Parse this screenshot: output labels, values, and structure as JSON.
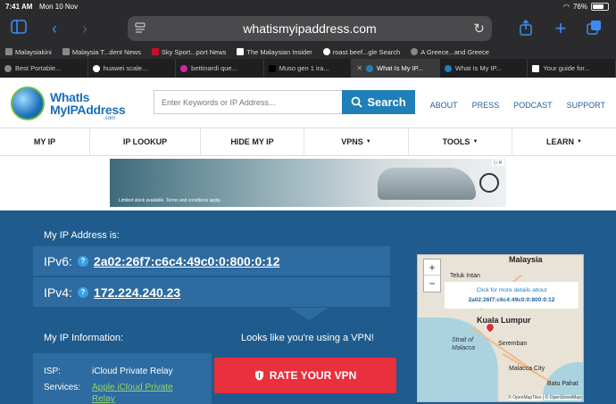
{
  "status": {
    "time": "7:41 AM",
    "date": "Mon 10 Nov",
    "battery": "76%"
  },
  "browser": {
    "url": "whatismyipaddress.com",
    "bookmarks": [
      {
        "label": "Malaysiakini"
      },
      {
        "label": "Malaysia T...dent News"
      },
      {
        "label": "Sky Sport...port News"
      },
      {
        "label": "The Malaysian Insider"
      },
      {
        "label": "roast beef...gle Search"
      },
      {
        "label": "A Greece...and Greece"
      }
    ],
    "tabs": [
      {
        "label": "Best Portable...",
        "active": false
      },
      {
        "label": "huawei scale...",
        "active": false
      },
      {
        "label": "bettinardi que...",
        "active": false
      },
      {
        "label": "Muso gen 1 ira...",
        "active": false
      },
      {
        "label": "What Is My IP...",
        "active": true
      },
      {
        "label": "What Is My IP...",
        "active": false
      },
      {
        "label": "Your guide for...",
        "active": false
      }
    ]
  },
  "site": {
    "logo": {
      "line1": "WhatIs",
      "line2": "MyIPAddress",
      "line3": ".com"
    },
    "search": {
      "placeholder": "Enter Keywords or IP Address...",
      "button": "Search"
    },
    "header_links": [
      "ABOUT",
      "PRESS",
      "PODCAST",
      "SUPPORT"
    ],
    "nav": [
      {
        "label": "MY IP",
        "caret": false
      },
      {
        "label": "IP LOOKUP",
        "caret": false
      },
      {
        "label": "HIDE MY IP",
        "caret": false
      },
      {
        "label": "VPNS",
        "caret": true
      },
      {
        "label": "TOOLS",
        "caret": true
      },
      {
        "label": "LEARN",
        "caret": true
      }
    ],
    "ad": {
      "fineprint": "Limited stock available. Terms and conditions apply."
    }
  },
  "hero": {
    "my_ip_label": "My IP Address is:",
    "ipv6_label": "IPv6:",
    "ipv6": "2a02:26f7:c6c4:49c0:0:800:0:12",
    "ipv4_label": "IPv4:",
    "ipv4": "172.224.240.23",
    "info_label": "My IP Information:",
    "vpn_msg": "Looks like you're using a VPN!",
    "rate_button": "RATE YOUR VPN",
    "isp_label": "ISP:",
    "isp": "iCloud Private Relay",
    "services_label": "Services:",
    "services_line1": "Apple iCloud Private",
    "services_line2": "Relay"
  },
  "map": {
    "popup_line1": "Click for more details about",
    "popup_line2": "2a02:26f7:c6c4:49c0:0:800:0:12",
    "places": {
      "malaysia": "Malaysia",
      "kl": "Kuala Lumpur",
      "seremban": "Seremban",
      "strait": "Strait of Malacca",
      "malacca": "Malacca City",
      "batu": "Batu Pahat",
      "telok": "Teluk Intan"
    },
    "attribution": "© OpenMapTiles | © OpenStreetMap"
  },
  "colors": {
    "accent": "#1f7fb8",
    "hero": "#1f5b8c",
    "rate": "#e9303d",
    "safari_blue": "#3b8cf5"
  }
}
